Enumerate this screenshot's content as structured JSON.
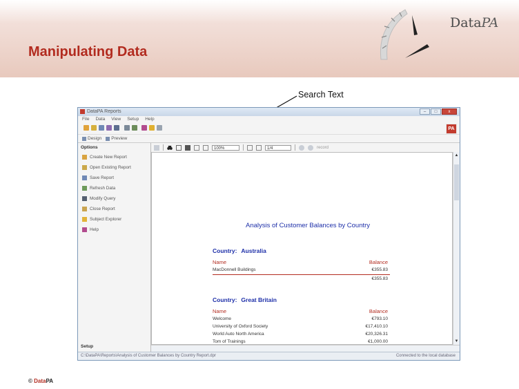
{
  "slide": {
    "title": "Manipulating Data",
    "logo_text": "Data",
    "logo_accent": "PA",
    "callout": "Search Text",
    "copyright_symbol": "©",
    "copyright_brand": "Data",
    "copyright_suffix": "PA",
    "accent_color": "#b22b1f"
  },
  "app": {
    "title": "DataPA Reports",
    "window_buttons": {
      "minimize": "–",
      "maximize": "□",
      "close": "x"
    },
    "menu": [
      "File",
      "Data",
      "View",
      "Setup",
      "Help"
    ],
    "toolbar2": {
      "design": "Design",
      "preview": "Preview"
    },
    "pa_badge": "PA",
    "sidebar": {
      "header": "Options",
      "items": [
        {
          "label": "Create New Report",
          "icon": "new-report-icon"
        },
        {
          "label": "Open Existing Report",
          "icon": "open-report-icon"
        },
        {
          "label": "Save Report",
          "icon": "save-report-icon"
        },
        {
          "label": "Refresh Data",
          "icon": "refresh-icon"
        },
        {
          "label": "Modify Query",
          "icon": "query-icon"
        },
        {
          "label": "Close Report",
          "icon": "close-report-icon"
        },
        {
          "label": "Subject Explorer",
          "icon": "explorer-icon"
        },
        {
          "label": "Help",
          "icon": "help-icon"
        }
      ],
      "footer": "Setup"
    },
    "preview_toolbar": {
      "zoom": "100%",
      "page": "1/4",
      "nav_label": "record"
    },
    "report": {
      "title": "Analysis of Customer Balances by Country",
      "groups": [
        {
          "country_label": "Country:",
          "country": "Australia",
          "name_header": "Name",
          "balance_header": "Balance",
          "rows": [
            {
              "name": "MacDonnell Buildings",
              "balance": "€355.83"
            }
          ],
          "total": "€355.83"
        },
        {
          "country_label": "Country:",
          "country": "Great Britain",
          "name_header": "Name",
          "balance_header": "Balance",
          "rows": [
            {
              "name": "Welcome",
              "balance": "€793.10"
            },
            {
              "name": "University of Oxford Society",
              "balance": "€17,410.10"
            },
            {
              "name": "World Auto North America",
              "balance": "€20,326.31"
            },
            {
              "name": "Tom of Trainings",
              "balance": "€1,000.00"
            }
          ]
        }
      ]
    },
    "status": {
      "left": "C:\\DataPA\\Reports\\Analysis of Customer Balances by Country Report.dpr",
      "right": "Connected to the local database"
    }
  }
}
